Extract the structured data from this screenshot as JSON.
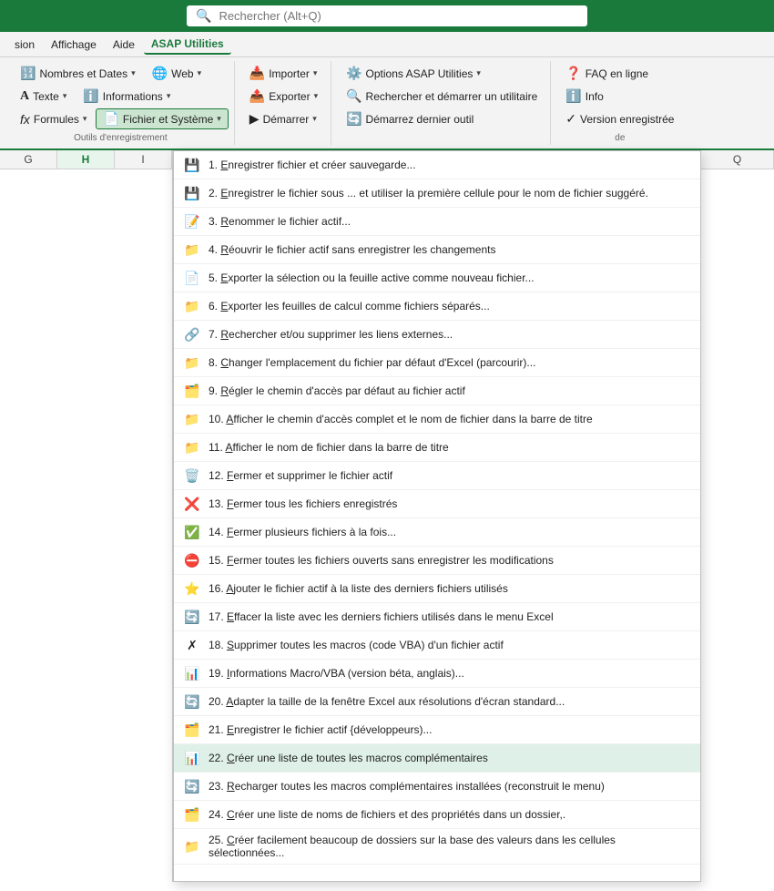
{
  "search": {
    "placeholder": "Rechercher (Alt+Q)"
  },
  "menubar": {
    "items": [
      "sion",
      "Affichage",
      "Aide",
      "ASAP Utilities"
    ]
  },
  "ribbon": {
    "groups": [
      {
        "label": "Outils d'enregistrement",
        "rows": [
          [
            {
              "icon": "🔢",
              "label": "Nombres et Dates",
              "dropdown": true
            },
            {
              "icon": "🌐",
              "label": "Web",
              "dropdown": true
            }
          ],
          [
            {
              "icon": "A",
              "label": "Texte",
              "dropdown": true
            },
            {
              "icon": "ℹ️",
              "label": "Informations",
              "dropdown": true
            }
          ],
          [
            {
              "icon": "fx",
              "label": "Formules",
              "dropdown": true
            },
            {
              "icon": "📄",
              "label": "Fichier et Système",
              "dropdown": true,
              "active": true
            }
          ]
        ]
      },
      {
        "label": "",
        "rows": [
          [
            {
              "icon": "📥",
              "label": "Importer",
              "dropdown": true
            },
            {
              "icon": "📤",
              "label": "Exporter",
              "dropdown": true
            },
            {
              "icon": "▶",
              "label": "Démarrer",
              "dropdown": true
            }
          ]
        ]
      },
      {
        "label": "",
        "rows": [
          [
            {
              "icon": "⚙️",
              "label": "Options ASAP Utilities",
              "dropdown": true
            },
            {
              "icon": "🔍",
              "label": "Rechercher et démarrer un utilitaire"
            },
            {
              "icon": "🔄",
              "label": "Démarrez dernier outil"
            }
          ]
        ]
      },
      {
        "label": "de",
        "rows": [
          [
            {
              "icon": "❓",
              "label": "FAQ en ligne"
            },
            {
              "icon": "ℹ️",
              "label": "Info"
            },
            {
              "icon": "✓",
              "label": "Version enregistrée"
            }
          ]
        ]
      }
    ]
  },
  "dropdown": {
    "items": [
      {
        "num": "1.",
        "underline_char": "E",
        "text": "Enregistrer fichier et créer sauvegarde...",
        "icon": "💾"
      },
      {
        "num": "2.",
        "underline_char": "E",
        "text": "Enregistrer le fichier sous ... et utiliser la première cellule pour le nom de fichier suggéré.",
        "icon": "💾"
      },
      {
        "num": "3.",
        "underline_char": "R",
        "text": "Renommer le fichier actif...",
        "icon": "📝"
      },
      {
        "num": "4.",
        "underline_char": "R",
        "text": "Réouvrir le fichier actif sans enregistrer les changements",
        "icon": "📁"
      },
      {
        "num": "5.",
        "underline_char": "E",
        "text": "Exporter la sélection ou la feuille active comme nouveau fichier...",
        "icon": "📄"
      },
      {
        "num": "6.",
        "underline_char": "E",
        "text": "Exporter les feuilles de calcul comme fichiers séparés...",
        "icon": "📁"
      },
      {
        "num": "7.",
        "underline_char": "R",
        "text": "Rechercher et/ou supprimer les liens externes...",
        "icon": "🔗"
      },
      {
        "num": "8.",
        "underline_char": "C",
        "text": "Changer l'emplacement du fichier par défaut d'Excel (parcourir)...",
        "icon": "📁"
      },
      {
        "num": "9.",
        "underline_char": "R",
        "text": "Régler le chemin d'accès par défaut au fichier actif",
        "icon": "🗂️"
      },
      {
        "num": "10.",
        "underline_char": "A",
        "text": "Afficher le chemin d'accès complet et le nom de fichier dans la barre de titre",
        "icon": "📁"
      },
      {
        "num": "11.",
        "underline_char": "A",
        "text": "Afficher le nom de fichier dans la barre de titre",
        "icon": "📁"
      },
      {
        "num": "12.",
        "underline_char": "F",
        "text": "Fermer et supprimer le fichier actif",
        "icon": "🗑️"
      },
      {
        "num": "13.",
        "underline_char": "F",
        "text": "Fermer tous les fichiers enregistrés",
        "icon": "❌"
      },
      {
        "num": "14.",
        "underline_char": "F",
        "text": "Fermer plusieurs fichiers à la fois...",
        "icon": "✅"
      },
      {
        "num": "15.",
        "underline_char": "F",
        "text": "Fermer toutes les fichiers ouverts sans enregistrer les modifications",
        "icon": "⛔"
      },
      {
        "num": "16.",
        "underline_char": "A",
        "text": "Ajouter le fichier actif  à la liste des derniers fichiers utilisés",
        "icon": "⭐"
      },
      {
        "num": "17.",
        "underline_char": "E",
        "text": "Effacer la liste avec les derniers fichiers utilisés dans le menu Excel",
        "icon": "🔄"
      },
      {
        "num": "18.",
        "underline_char": "S",
        "text": "Supprimer toutes les macros (code VBA) d'un fichier actif",
        "icon": "✗"
      },
      {
        "num": "19.",
        "underline_char": "I",
        "text": "Informations Macro/VBA (version béta, anglais)...",
        "icon": "📊"
      },
      {
        "num": "20.",
        "underline_char": "A",
        "text": "Adapter la taille de la fenêtre Excel aux résolutions d'écran standard...",
        "icon": "🔄"
      },
      {
        "num": "21.",
        "underline_char": "E",
        "text": "Enregistrer le fichier actif  {développeurs)...",
        "icon": "🗂️"
      },
      {
        "num": "22.",
        "underline_char": "C",
        "text": "Créer une liste de toutes les macros complémentaires",
        "icon": "📊",
        "highlighted": true
      },
      {
        "num": "23.",
        "underline_char": "R",
        "text": "Recharger toutes les macros complémentaires installées (reconstruit le menu)",
        "icon": "🔄"
      },
      {
        "num": "24.",
        "underline_char": "C",
        "text": "Créer une liste de noms de fichiers et des propriétés dans un dossier,.",
        "icon": "🗂️"
      },
      {
        "num": "25.",
        "underline_char": "C",
        "text": "Créer facilement beaucoup de dossiers sur la base des valeurs dans les cellules sélectionnées...",
        "icon": "📁"
      }
    ]
  },
  "columns": {
    "left": [
      "G",
      "H",
      "I"
    ],
    "right": [
      "Q"
    ]
  }
}
